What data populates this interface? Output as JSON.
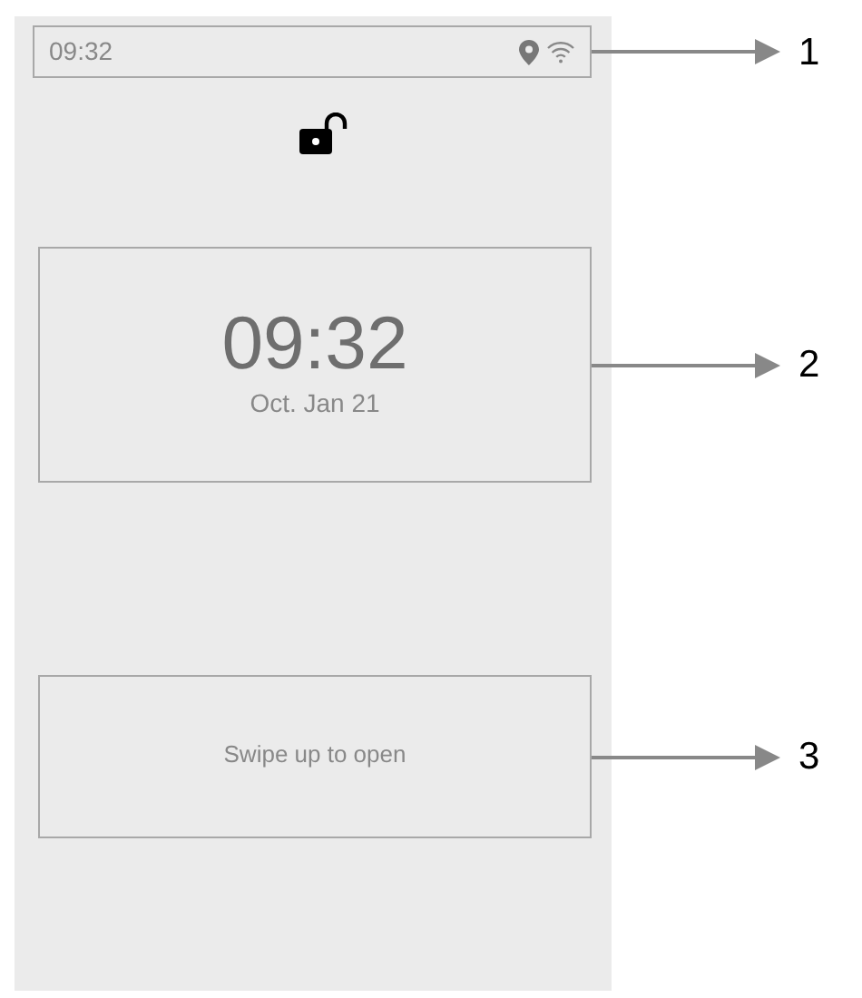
{
  "status_bar": {
    "time": "09:32",
    "callout": "1"
  },
  "clock": {
    "time": "09:32",
    "date": "Oct. Jan 21",
    "callout": "2"
  },
  "unlock": {
    "hint": "Swipe up to open",
    "callout": "3"
  }
}
